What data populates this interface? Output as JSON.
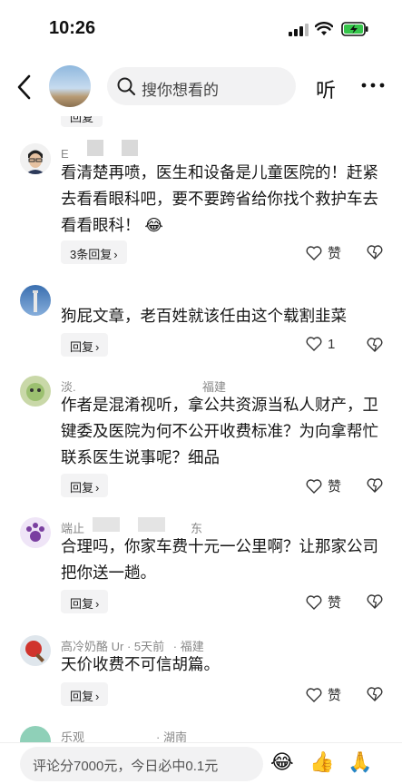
{
  "status": {
    "time": "10:26"
  },
  "nav": {
    "search_placeholder": "搜你想看的",
    "listen_label": "听"
  },
  "top_partial_reply": "回复",
  "comments": [
    {
      "name": "E",
      "text": "看清楚再喷，医生和设备是儿童医院的！赶紧去看看眼科吧，要不要跨省给你找个救护车去看看眼科！",
      "reply_label": "3条回复",
      "like": "赞"
    },
    {
      "name": "",
      "text": "狗屁文章，老百姓就该任由这个载割韭菜",
      "reply_label": "回复",
      "like": "1"
    },
    {
      "name": "淡.",
      "location": "福建",
      "text": "作者是混淆视听，拿公共资源当私人财产，卫键委及医院为何不公开收费标准？为向拿帮忙联系医生说事呢？细品",
      "reply_label": "回复",
      "like": "赞"
    },
    {
      "name": "端止",
      "location": "东",
      "text": "合理吗，你家车费十元一公里啊？让那家公司把你送一趟。",
      "reply_label": "回复",
      "like": "赞"
    },
    {
      "name": "高冷奶酪 Ur · 5天前",
      "location": "福建",
      "text": "天价收费不可信胡篇。",
      "reply_label": "回复",
      "like": "赞"
    },
    {
      "name": "乐观",
      "location": "· 湖南"
    }
  ],
  "bottom": {
    "input_text": "评论分7000元，今日必中0.1元",
    "emojis": [
      "😂",
      "👍",
      "🙏"
    ]
  },
  "colors": {
    "text": "#161616",
    "meta": "#888888",
    "chip_bg": "#f3f3f4",
    "search_bg": "#f2f2f3"
  }
}
